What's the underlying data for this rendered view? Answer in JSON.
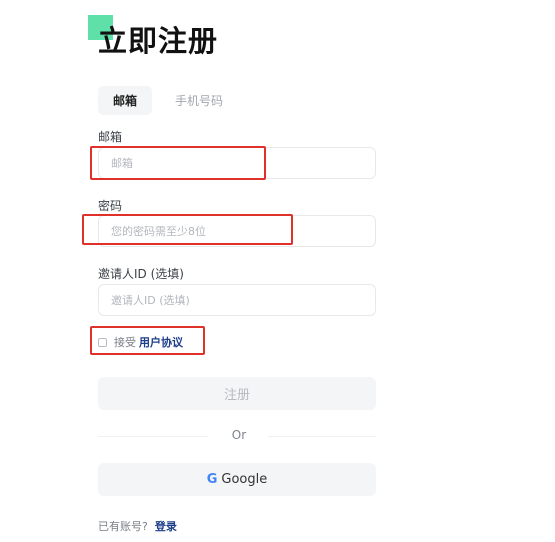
{
  "header": {
    "title": "立即注册"
  },
  "tabs": [
    {
      "label": "邮箱",
      "active": true
    },
    {
      "label": "手机号码",
      "active": false
    }
  ],
  "form": {
    "email": {
      "label": "邮箱",
      "placeholder": "邮箱",
      "value": ""
    },
    "password": {
      "label": "密码",
      "placeholder": "您的密码需至少8位",
      "value": ""
    },
    "inviter": {
      "label": "邀请人ID (选填)",
      "placeholder": "邀请人ID (选填)",
      "value": ""
    },
    "agreement": {
      "prefix": "接受",
      "link": "用户协议",
      "checked": false
    }
  },
  "buttons": {
    "register": "注册",
    "google": "Google"
  },
  "divider": {
    "text": "Or"
  },
  "footer": {
    "question": "已有账号?",
    "login": "登录"
  },
  "colors": {
    "accent": "#5fe0a8",
    "link": "#1e3e8a",
    "highlight": "#e0302a"
  },
  "icons": {
    "google": "google-icon"
  }
}
